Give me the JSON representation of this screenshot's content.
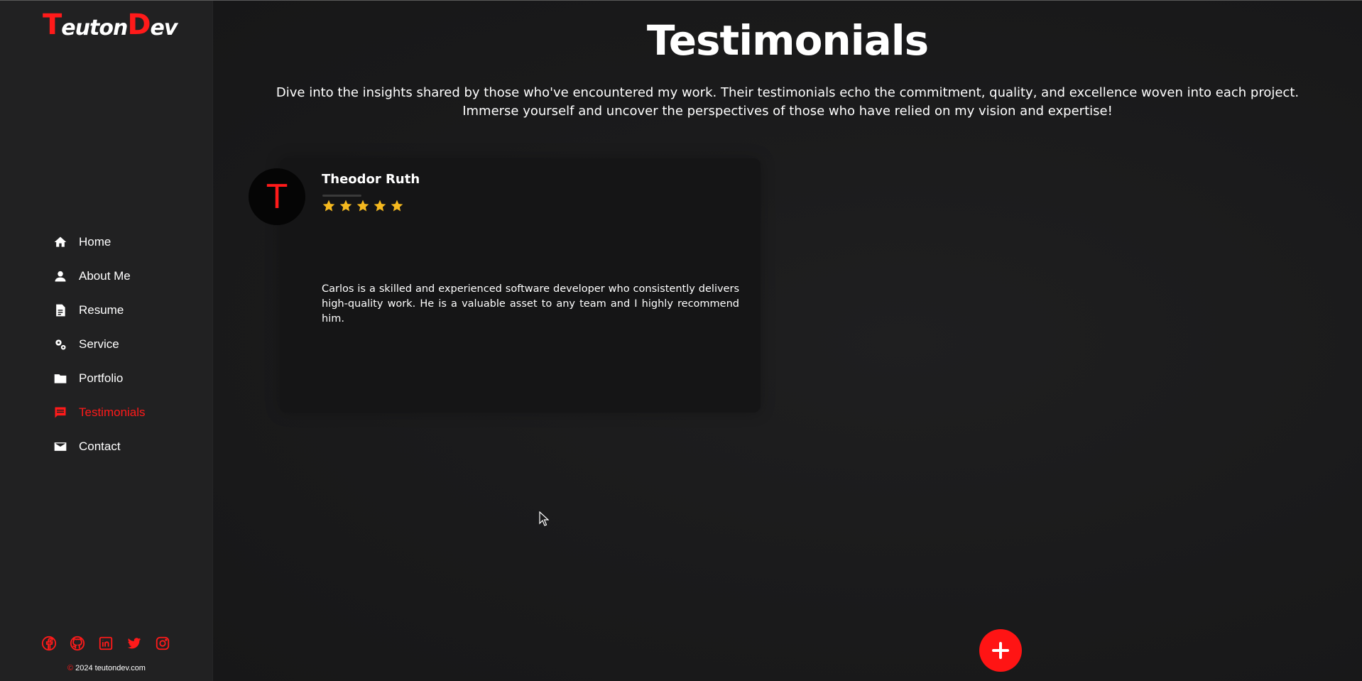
{
  "brand": {
    "logo_first": "T",
    "logo_mid": "euton",
    "logo_second": "D",
    "logo_end": "ev"
  },
  "nav": {
    "items": [
      {
        "label": "Home",
        "icon": "home-icon"
      },
      {
        "label": "About Me",
        "icon": "person-icon"
      },
      {
        "label": "Resume",
        "icon": "document-icon"
      },
      {
        "label": "Service",
        "icon": "gears-icon"
      },
      {
        "label": "Portfolio",
        "icon": "folder-icon"
      },
      {
        "label": "Testimonials",
        "icon": "chat-icon",
        "active": true
      },
      {
        "label": "Contact",
        "icon": "mail-icon"
      }
    ]
  },
  "socials": [
    "facebook-icon",
    "github-icon",
    "linkedin-icon",
    "twitter-icon",
    "instagram-icon"
  ],
  "footer": {
    "copyright": "2024 teutondev.com"
  },
  "page": {
    "title": "Testimonials",
    "intro": "Dive into the insights shared by those who've encountered my work. Their testimonials echo the commitment, quality, and excellence woven into each project. Immerse yourself and uncover the perspectives of those who have relied on my vision and expertise!"
  },
  "testimonials": [
    {
      "avatar_letter": "T",
      "name": "Theodor Ruth",
      "rating": 5,
      "text": "Carlos is a skilled and experienced software developer who consistently delivers high-quality work. He is a valuable asset to any team and I highly recommend him."
    }
  ],
  "colors": {
    "accent": "#ff1a1a",
    "star": "#f5b91f",
    "background": "#1b1b1c",
    "sidebar": "#212122"
  }
}
